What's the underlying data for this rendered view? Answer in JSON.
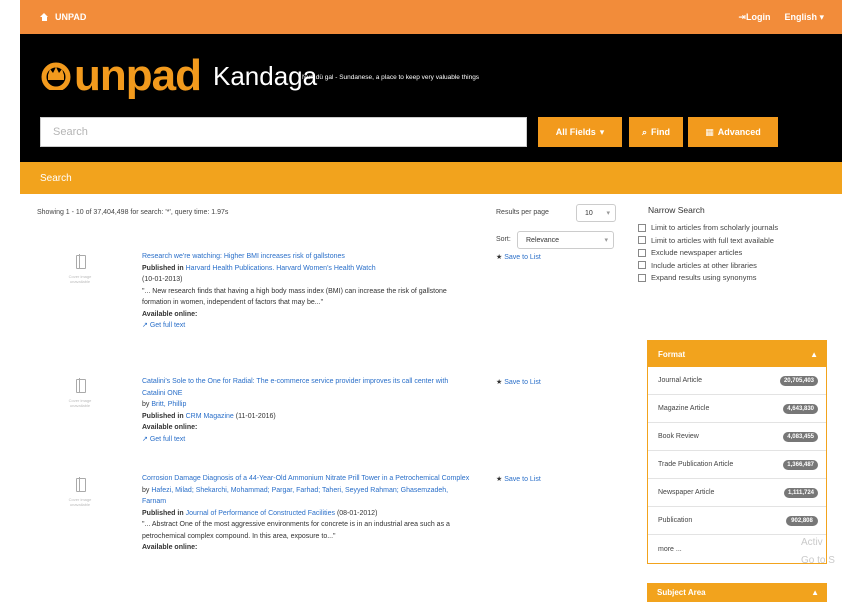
{
  "topbar": {
    "home_label": "UNPAD",
    "login_label": "Login",
    "language_label": "English"
  },
  "header": {
    "logo_text": "unpad",
    "product": "Kandaga",
    "tagline": "Nun dü gal - Sundanese, a place to keep very valuable things"
  },
  "search": {
    "placeholder": "Search",
    "scope_label": "All Fields",
    "find_label": "Find",
    "advanced_label": "Advanced"
  },
  "breadcrumb": {
    "current": "Search"
  },
  "results_info": {
    "showing": "Showing 1 - 10 of 37,404,498 for search: '*', query time: 1.97s",
    "per_page_label": "Results per page",
    "per_page_value": "10",
    "sort_label": "Sort",
    "sort_value": "Relevance"
  },
  "thumb_caption": "Cover image unavailable",
  "save_label": "Save to List",
  "results": [
    {
      "title": "Research we're watching: Higher BMI increases risk of gallstones",
      "published_label": "Published in",
      "journal": "Harvard Health Publications. Harvard Women's Health Watch",
      "date": "(10-01-2013)",
      "snippet": "\"... New research finds that having a high body mass index (BMI) can increase the risk of gallstone formation in women, independent of factors that may be...\"",
      "available": "Available online:",
      "fulltext": "Get full text"
    },
    {
      "title": "Catalini's Sole to the One for Radial: The e-commerce service provider improves its call center with Catalini ONE",
      "author_prefix": "by",
      "author": "Britt, Phillip",
      "published_label": "Published in",
      "journal": "CRM Magazine",
      "date": "(11-01-2016)",
      "available": "Available online:",
      "fulltext": "Get full text"
    },
    {
      "title": "Corrosion Damage Diagnosis of a 44-Year-Old Ammonium Nitrate Prill Tower in a Petrochemical Complex",
      "author_prefix": "by",
      "author": "Hafezi, Milad; Shekarchi, Mohammad; Pargar, Farhad; Taheri, Seyyed Rahman; Ghasemzadeh, Farnam",
      "published_label": "Published in",
      "journal": "Journal of Performance of Constructed Facilities",
      "date": "(08-01-2012)",
      "snippet": "\"... Abstract One of the most aggressive environments for concrete is in an industrial area such as a petrochemical complex compound. In this area, exposure to...\"",
      "available": "Available online:"
    }
  ],
  "narrow": {
    "title": "Narrow Search",
    "checkboxes": [
      "Limit to articles from scholarly journals",
      "Limit to articles with full text available",
      "Exclude newspaper articles",
      "Include articles at other libraries",
      "Expand results using synonyms"
    ]
  },
  "format_facet": {
    "title": "Format",
    "items": [
      {
        "label": "Journal Article",
        "count": "20,705,403"
      },
      {
        "label": "Magazine Article",
        "count": "4,643,830"
      },
      {
        "label": "Book Review",
        "count": "4,083,455"
      },
      {
        "label": "Trade Publication Article",
        "count": "1,366,487"
      },
      {
        "label": "Newspaper Article",
        "count": "1,111,724"
      },
      {
        "label": "Publication",
        "count": "902,808"
      }
    ],
    "more": "more ..."
  },
  "subject_facet": {
    "title": "Subject Area"
  },
  "os_watermark": {
    "line1": "Activ",
    "line2": "Go to S"
  }
}
